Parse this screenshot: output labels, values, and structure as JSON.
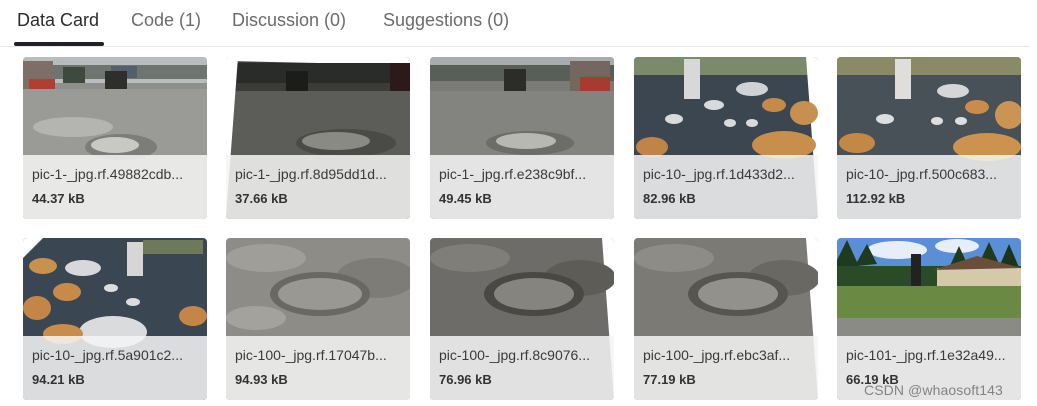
{
  "tabs": [
    {
      "label": "Data Card",
      "active": true
    },
    {
      "label": "Code (1)",
      "active": false
    },
    {
      "label": "Discussion (0)",
      "active": false
    },
    {
      "label": "Suggestions (0)",
      "active": false
    }
  ],
  "cards": [
    {
      "filename": "pic-1-_jpg.rf.49882cdb...",
      "size": "44.37 kB",
      "scene": "flooded-street-dim"
    },
    {
      "filename": "pic-1-_jpg.rf.8d95dd1d...",
      "size": "37.66 kB",
      "scene": "flooded-street-dark"
    },
    {
      "filename": "pic-1-_jpg.rf.e238c9bf...",
      "size": "49.45 kB",
      "scene": "flooded-street"
    },
    {
      "filename": "pic-10-_jpg.rf.1d433d2...",
      "size": "82.96 kB",
      "scene": "potholes"
    },
    {
      "filename": "pic-10-_jpg.rf.500c683...",
      "size": "112.92 kB",
      "scene": "potholes"
    },
    {
      "filename": "pic-10-_jpg.rf.5a901c2...",
      "size": "94.21 kB",
      "scene": "potholes-rotated"
    },
    {
      "filename": "pic-100-_jpg.rf.17047b...",
      "size": "94.93 kB",
      "scene": "pothole-closeup"
    },
    {
      "filename": "pic-100-_jpg.rf.8c9076...",
      "size": "76.96 kB",
      "scene": "pothole-closeup-tilted"
    },
    {
      "filename": "pic-100-_jpg.rf.ebc3af...",
      "size": "77.19 kB",
      "scene": "pothole-closeup-tilted"
    },
    {
      "filename": "pic-101-_jpg.rf.1e32a49...",
      "size": "66.19 kB",
      "scene": "park-road"
    }
  ],
  "watermark": "CSDN @whaosoft143"
}
